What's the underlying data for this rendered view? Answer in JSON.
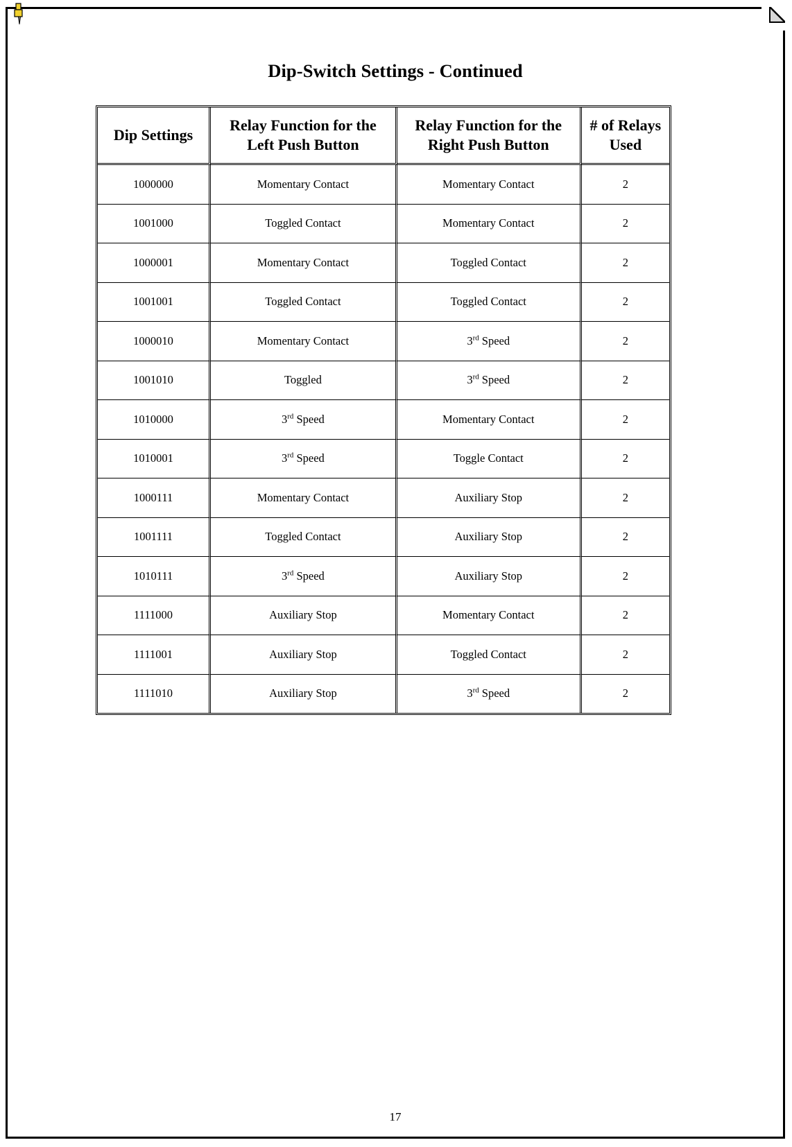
{
  "document": {
    "title": "Dip-Switch Settings - Continued",
    "page_number": "17"
  },
  "decorations": {
    "pushpin_icon": "pushpin-icon",
    "fold_corner_icon": "folded-page-corner-icon",
    "pushpin_color": "#F2D22E",
    "border_color": "#000000"
  },
  "table": {
    "headers": [
      "Dip Settings",
      "Relay Function for the Left Push Button",
      "Relay Function for the Right Push Button",
      "# of Relays Used"
    ],
    "header_lines": [
      [
        "Dip Settings"
      ],
      [
        "Relay Function for the",
        "Left Push Button"
      ],
      [
        "Relay Function for the",
        "Right Push Button"
      ],
      [
        "# of Relays",
        "Used"
      ]
    ],
    "rows": [
      {
        "dip": "1000000",
        "left": "Momentary Contact",
        "left_sup": "",
        "left_tail": "",
        "right": "Momentary Contact",
        "right_sup": "",
        "right_tail": "",
        "relays": "2"
      },
      {
        "dip": "1001000",
        "left": "Toggled Contact",
        "left_sup": "",
        "left_tail": "",
        "right": "Momentary Contact",
        "right_sup": "",
        "right_tail": "",
        "relays": "2"
      },
      {
        "dip": "1000001",
        "left": "Momentary Contact",
        "left_sup": "",
        "left_tail": "",
        "right": "Toggled Contact",
        "right_sup": "",
        "right_tail": "",
        "relays": "2"
      },
      {
        "dip": "1001001",
        "left": "Toggled Contact",
        "left_sup": "",
        "left_tail": "",
        "right": "Toggled Contact",
        "right_sup": "",
        "right_tail": "",
        "relays": "2"
      },
      {
        "dip": "1000010",
        "left": "Momentary Contact",
        "left_sup": "",
        "left_tail": "",
        "right": "3",
        "right_sup": "rd",
        "right_tail": " Speed",
        "relays": "2"
      },
      {
        "dip": "1001010",
        "left": "Toggled",
        "left_sup": "",
        "left_tail": "",
        "right": "3",
        "right_sup": "rd",
        "right_tail": " Speed",
        "relays": "2"
      },
      {
        "dip": "1010000",
        "left": "3",
        "left_sup": "rd",
        "left_tail": " Speed",
        "right": "Momentary Contact",
        "right_sup": "",
        "right_tail": "",
        "relays": "2"
      },
      {
        "dip": "1010001",
        "left": "3",
        "left_sup": "rd",
        "left_tail": " Speed",
        "right": "Toggle Contact",
        "right_sup": "",
        "right_tail": "",
        "relays": "2"
      },
      {
        "dip": "1000111",
        "left": "Momentary Contact",
        "left_sup": "",
        "left_tail": "",
        "right": "Auxiliary Stop",
        "right_sup": "",
        "right_tail": "",
        "relays": "2"
      },
      {
        "dip": "1001111",
        "left": "Toggled Contact",
        "left_sup": "",
        "left_tail": "",
        "right": "Auxiliary Stop",
        "right_sup": "",
        "right_tail": "",
        "relays": "2"
      },
      {
        "dip": "1010111",
        "left": "3",
        "left_sup": "rd",
        "left_tail": " Speed",
        "right": "Auxiliary Stop",
        "right_sup": "",
        "right_tail": "",
        "relays": "2"
      },
      {
        "dip": "1111000",
        "left": "Auxiliary Stop",
        "left_sup": "",
        "left_tail": "",
        "right": "Momentary Contact",
        "right_sup": "",
        "right_tail": "",
        "relays": "2"
      },
      {
        "dip": "1111001",
        "left": "Auxiliary Stop",
        "left_sup": "",
        "left_tail": "",
        "right": "Toggled Contact",
        "right_sup": "",
        "right_tail": "",
        "relays": "2"
      },
      {
        "dip": "1111010",
        "left": "Auxiliary Stop",
        "left_sup": "",
        "left_tail": "",
        "right": "3",
        "right_sup": "rd",
        "right_tail": " Speed",
        "relays": "2"
      }
    ]
  }
}
